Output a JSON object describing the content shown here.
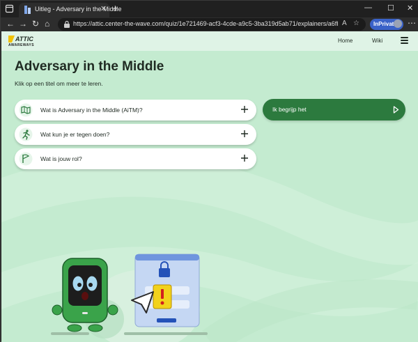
{
  "browser": {
    "tab_title": "Uitleg - Adversary in the Middle",
    "tab_close": "✕",
    "new_tab": "+",
    "url": "https://attic.center-the-wave.com/quiz/1e721469-acf3-4cde-a9c5-3ba319d5ab71/explainers/a6fb5a2c-3Bea-452F-...",
    "inprivate_label": "InPrivate",
    "window_controls": {
      "minimize": "—",
      "maximize": "☐",
      "close": "✕"
    },
    "nav": {
      "back": "←",
      "forward": "→",
      "refresh": "↻",
      "home": "⌂"
    },
    "url_icons": {
      "read_aloud": "A",
      "favorite": "☆",
      "collections": "⧉"
    },
    "more": "⋯"
  },
  "header": {
    "logo_text": "ATTIC",
    "logo_sub": "AWAREWAYS",
    "nav_home": "Home",
    "nav_wiki": "Wiki"
  },
  "main": {
    "title": "Adversary in the Middle",
    "subtitle": "Klik op een titel om meer te leren.",
    "accordion": [
      {
        "label": "Wat is Adversary in the Middle (AiTM)?",
        "icon": "map-icon"
      },
      {
        "label": "Wat kun je er tegen doen?",
        "icon": "running-person-icon"
      },
      {
        "label": "Wat is jouw rol?",
        "icon": "flag-icon"
      }
    ],
    "cta_label": "Ik begrijp het"
  },
  "colors": {
    "page_bg": "#c4ebd0",
    "header_bg": "#dff3e6",
    "accent_green": "#2c7a3e",
    "text_dark": "#1f2a22",
    "inprivate_blue": "#3a62c8"
  }
}
